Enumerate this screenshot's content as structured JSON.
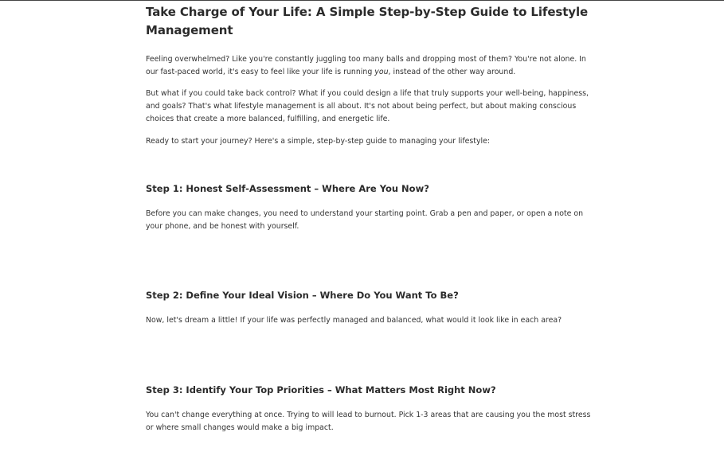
{
  "article": {
    "title": "Take Charge of Your Life: A Simple Step-by-Step Guide to Lifestyle Management",
    "intro_1_pre": "Feeling overwhelmed? Like you're constantly juggling too many balls and dropping most of them? You're not alone. In our fast-paced world, it's easy to feel like your life is running ",
    "intro_1_em": "you",
    "intro_1_post": ", instead of the other way around.",
    "intro_2": "But what if you could take back control? What if you could design a life that truly supports your well-being, happiness, and goals? That's what lifestyle management is all about. It's not about being perfect, but about making conscious choices that create a more balanced, fulfilling, and energetic life.",
    "intro_3": "Ready to start your journey? Here's a simple, step-by-step guide to managing your lifestyle:",
    "steps": [
      {
        "heading": "Step 1: Honest Self-Assessment – Where Are You Now?",
        "body": "Before you can make changes, you need to understand your starting point. Grab a pen and paper, or open a note on your phone, and be honest with yourself."
      },
      {
        "heading": "Step 2: Define Your Ideal Vision – Where Do You Want To Be?",
        "body": "Now, let's dream a little! If your life was perfectly managed and balanced, what would it look like in each area?"
      },
      {
        "heading": "Step 3: Identify Your Top Priorities – What Matters Most Right Now?",
        "body": "You can't change everything at once. Trying to will lead to burnout. Pick 1-3 areas that are causing you the most stress or where small changes would make a big impact."
      }
    ]
  }
}
